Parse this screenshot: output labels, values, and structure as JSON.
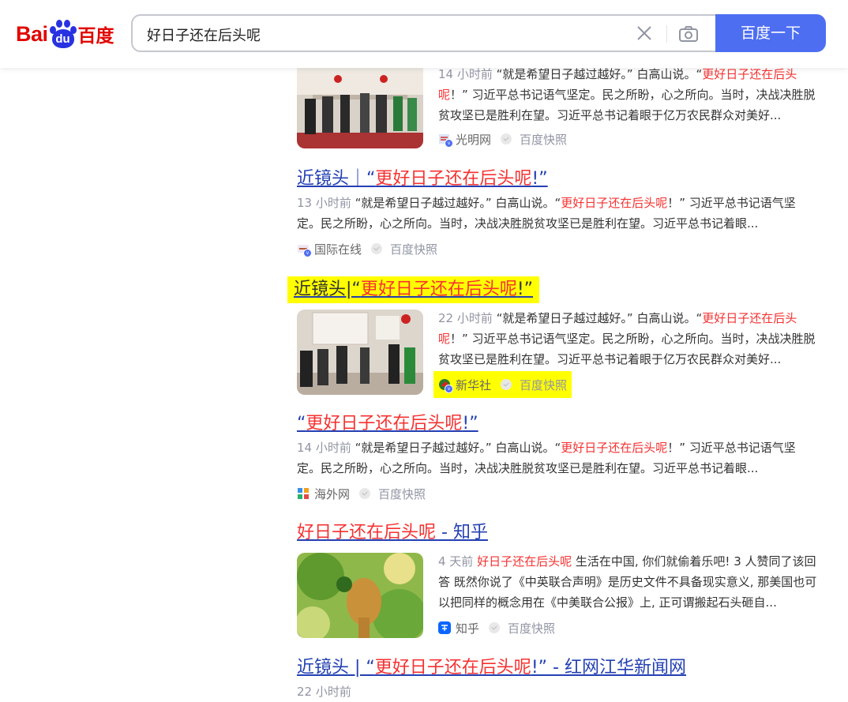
{
  "search": {
    "query": "好日子还在后头呢",
    "button_label": "百度一下",
    "logo_bai": "Bai",
    "logo_du": "du",
    "logo_cn": "百度"
  },
  "results": [
    {
      "time": "14 小时前",
      "line1_pre": "“就是希望日子越过越好。” 白高山说。“",
      "line1_em": "更好日子还在后头",
      "line2_em": "呢",
      "line2_post": "！” 习近平总书记语气坚定。民之所盼，心之所向。当时，决战决胜脱",
      "line3": "贫攻坚已是胜利在望。习近平总书记着眼于亿万农民群众对美好...",
      "source": "光明网",
      "cache": "百度快照"
    },
    {
      "title_pre": "近镜头｜“",
      "title_em": "更好日子还在后头呢",
      "title_post": "!”",
      "time": "13 小时前",
      "line1_pre": "“就是希望日子越过越好。” 白高山说。“",
      "line1_em": "更好日子还在后头呢",
      "line1_post": "！” 习近平总书记语气坚",
      "line2": "定。民之所盼，心之所向。当时，决战决胜脱贫攻坚已是胜利在望。习近平总书记着眼...",
      "source": "国际在线",
      "cache": "百度快照"
    },
    {
      "title_pre": "近镜头|“",
      "title_em": "更好日子还在后头呢",
      "title_post": "!”",
      "time": "22 小时前",
      "line1_pre": "“就是希望日子越过越好。” 白高山说。“",
      "line1_em": "更好日子还在后头",
      "line2_em": "呢",
      "line2_post": "！” 习近平总书记语气坚定。民之所盼，心之所向。当时，决战决胜脱",
      "line3": "贫攻坚已是胜利在望。习近平总书记着眼于亿万农民群众对美好...",
      "source": "新华社",
      "cache": "百度快照"
    },
    {
      "title_pre": "“",
      "title_em": "更好日子还在后头呢",
      "title_post": "!”",
      "time": "14 小时前",
      "line1_pre": "“就是希望日子越过越好。” 白高山说。“",
      "line1_em": "更好日子还在后头呢",
      "line1_post": "！” 习近平总书记语气坚",
      "line2": "定。民之所盼，心之所向。当时，决战决胜脱贫攻坚已是胜利在望。习近平总书记着眼...",
      "source": "海外网",
      "cache": "百度快照"
    },
    {
      "title_em": "好日子还在后头呢",
      "title_post": " - 知乎",
      "time": "4 天前",
      "line1_em": "好日子还在后头呢",
      "line1_post": " 生活在中国, 你们就偷着乐吧! 3 人赞同了该回",
      "line2": "答 既然你说了《中英联合声明》是历史文件不具备现实意义, 那美国也可",
      "line3": "以把同样的概念用在《中美联合公报》上, 正可谓搬起石头砸自...",
      "source": "知乎",
      "cache": "百度快照"
    },
    {
      "title_pre": "近镜头 | “",
      "title_em": "更好日子还在后头呢",
      "title_post": "!” - 红网江华新闻网",
      "time": "22 小时前"
    }
  ],
  "colors": {
    "link": "#2440b3",
    "highlight": "#f73131",
    "button": "#4e6ef2",
    "annotation": "#ffff00"
  }
}
